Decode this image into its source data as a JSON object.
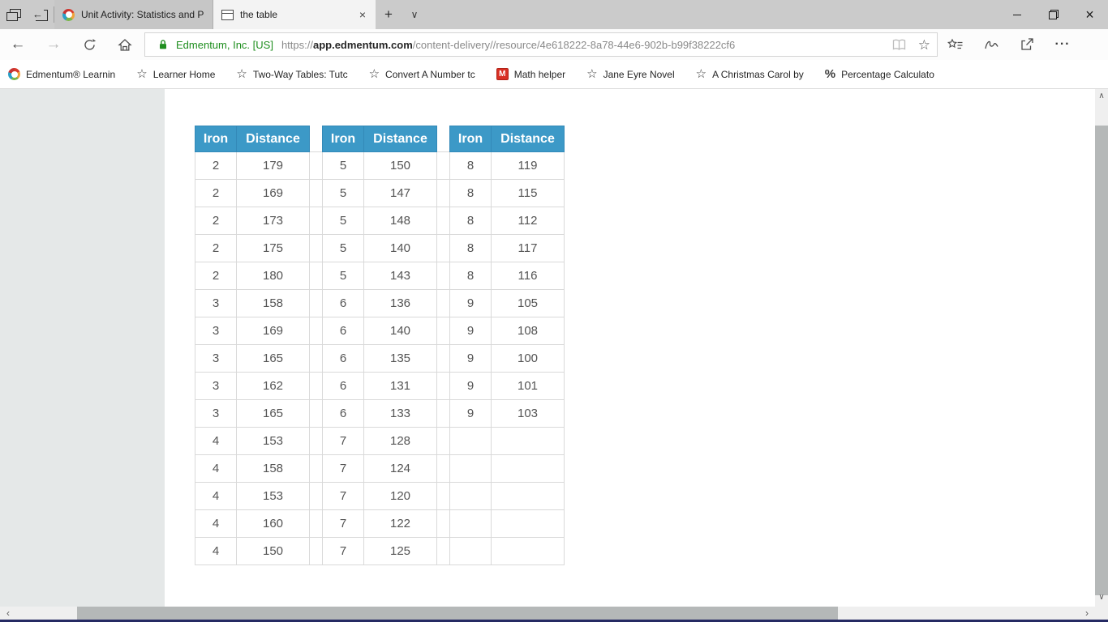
{
  "icons": {
    "back": "←",
    "forward": "→",
    "set_aside_arrow": "←",
    "star": "☆",
    "close": "×",
    "new_tab": "+",
    "tab_menu": "∨",
    "more": "···",
    "math_badge": "M",
    "percent": "%",
    "scroll_up": "∧",
    "scroll_down": "∨",
    "scroll_left": "‹",
    "scroll_right": "›"
  },
  "tabs": {
    "inactive": {
      "title": "Unit Activity: Statistics and P"
    },
    "active": {
      "title": "the table"
    }
  },
  "address_bar": {
    "security_name": "Edmentum, Inc. [US]",
    "url_scheme": "https://",
    "url_host": "app.edmentum.com",
    "url_path": "/content-delivery//resource/4e618222-8a78-44e6-902b-b99f38222cf6"
  },
  "bookmarks_bar": {
    "items": [
      {
        "icon": "edmentum-logo",
        "label": "Edmentum® Learnin"
      },
      {
        "icon": "star",
        "label": "Learner Home"
      },
      {
        "icon": "star",
        "label": "Two-Way Tables: Tutc"
      },
      {
        "icon": "star",
        "label": "Convert A Number tc"
      },
      {
        "icon": "math-badge",
        "label": "Math helper"
      },
      {
        "icon": "star",
        "label": "Jane Eyre Novel"
      },
      {
        "icon": "star",
        "label": "A Christmas Carol by"
      },
      {
        "icon": "percent",
        "label": "Percentage Calculato"
      }
    ]
  },
  "page": {
    "header_color": "#3c99c7",
    "tables": [
      {
        "headers": [
          "Iron",
          "Distance"
        ],
        "rows": [
          [
            2,
            179
          ],
          [
            2,
            169
          ],
          [
            2,
            173
          ],
          [
            2,
            175
          ],
          [
            2,
            180
          ],
          [
            3,
            158
          ],
          [
            3,
            169
          ],
          [
            3,
            165
          ],
          [
            3,
            162
          ],
          [
            3,
            165
          ],
          [
            4,
            153
          ],
          [
            4,
            158
          ],
          [
            4,
            153
          ],
          [
            4,
            160
          ],
          [
            4,
            150
          ]
        ]
      },
      {
        "headers": [
          "Iron",
          "Distance"
        ],
        "rows": [
          [
            5,
            150
          ],
          [
            5,
            147
          ],
          [
            5,
            148
          ],
          [
            5,
            140
          ],
          [
            5,
            143
          ],
          [
            6,
            136
          ],
          [
            6,
            140
          ],
          [
            6,
            135
          ],
          [
            6,
            131
          ],
          [
            6,
            133
          ],
          [
            7,
            128
          ],
          [
            7,
            124
          ],
          [
            7,
            120
          ],
          [
            7,
            122
          ],
          [
            7,
            125
          ]
        ]
      },
      {
        "headers": [
          "Iron",
          "Distance"
        ],
        "rows": [
          [
            8,
            119
          ],
          [
            8,
            115
          ],
          [
            8,
            112
          ],
          [
            8,
            117
          ],
          [
            8,
            116
          ],
          [
            9,
            105
          ],
          [
            9,
            108
          ],
          [
            9,
            100
          ],
          [
            9,
            101
          ],
          [
            9,
            103
          ],
          [
            "",
            ""
          ],
          [
            "",
            ""
          ],
          [
            "",
            ""
          ],
          [
            "",
            ""
          ],
          [
            "",
            ""
          ]
        ]
      }
    ]
  },
  "colors": {
    "table_header_blue": "#3c99c7",
    "ev_green": "#1e8e1e",
    "bottom_strip_navy": "#252a63",
    "left_pane_gray": "#e5e8e8"
  }
}
